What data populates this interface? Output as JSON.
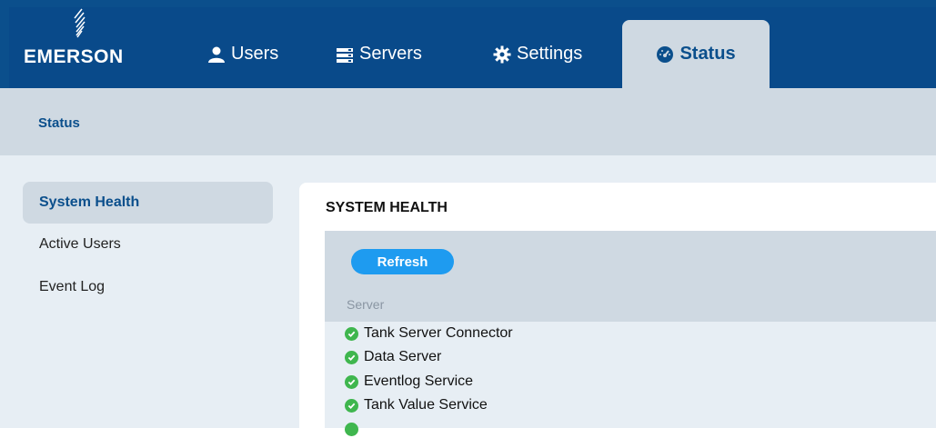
{
  "brand": {
    "name": "EMERSON"
  },
  "nav": {
    "tabs": [
      {
        "label": "Users",
        "icon": "user-icon"
      },
      {
        "label": "Servers",
        "icon": "server-icon"
      },
      {
        "label": "Settings",
        "icon": "gear-icon"
      },
      {
        "label": "Status",
        "icon": "dashboard-gauge-icon",
        "active": true
      }
    ]
  },
  "subheader": {
    "title": "Status"
  },
  "sidebar": {
    "items": [
      {
        "label": "System Health",
        "active": true
      },
      {
        "label": "Active Users"
      },
      {
        "label": "Event Log"
      }
    ]
  },
  "panel": {
    "title": "SYSTEM HEALTH",
    "refresh_label": "Refresh",
    "column_header": "Server",
    "rows": [
      {
        "name": "Tank Server Connector",
        "status": "ok"
      },
      {
        "name": "Data Server",
        "status": "ok"
      },
      {
        "name": "Eventlog Service",
        "status": "ok"
      },
      {
        "name": "Tank Value Service",
        "status": "ok"
      }
    ]
  },
  "colors": {
    "header_blue": "#094a8a",
    "accent_light": "#cfd9e2",
    "content_bg": "#e7eef4",
    "button_blue": "#1e9bf0",
    "status_ok": "#3fb64e"
  }
}
